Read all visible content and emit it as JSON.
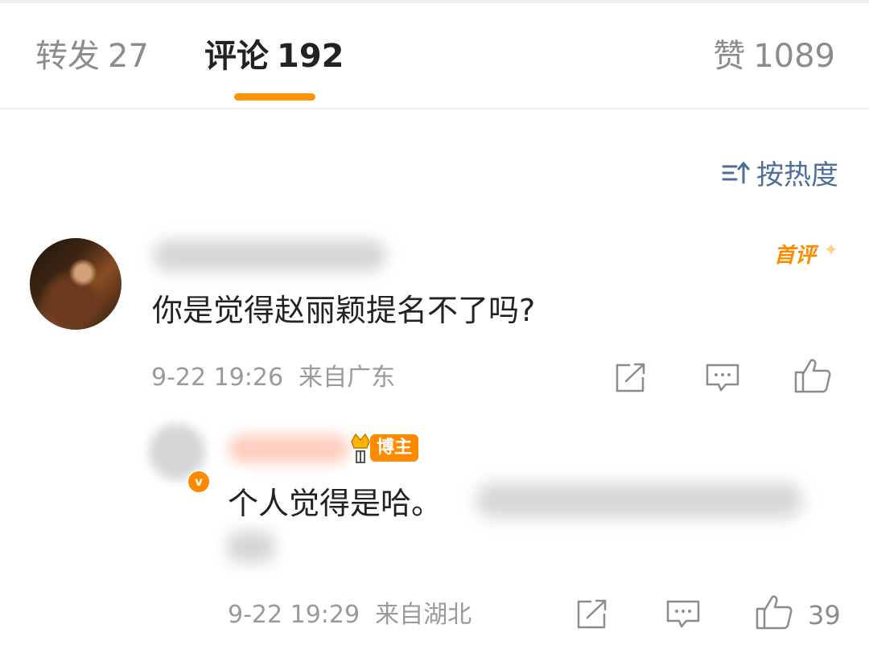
{
  "tabs": [
    {
      "label": "转发",
      "count": "27"
    },
    {
      "label": "评论",
      "count": "192"
    },
    {
      "label": "赞",
      "count": "1089"
    }
  ],
  "sort": {
    "label": "按热度",
    "icon": "sort-icon"
  },
  "comment": {
    "badge": "首评",
    "text": "你是觉得赵丽颖提名不了吗?",
    "time": "9-22 19:26",
    "location": "来自广东"
  },
  "reply": {
    "badge": "博主",
    "verify_mark": "v",
    "text": "个人觉得是哈。",
    "time": "9-22 19:29",
    "location": "来自湖北",
    "likes": "39"
  },
  "colors": {
    "accent": "#ff9500",
    "link": "#4d6f9a",
    "meta": "#9a9a9a"
  }
}
